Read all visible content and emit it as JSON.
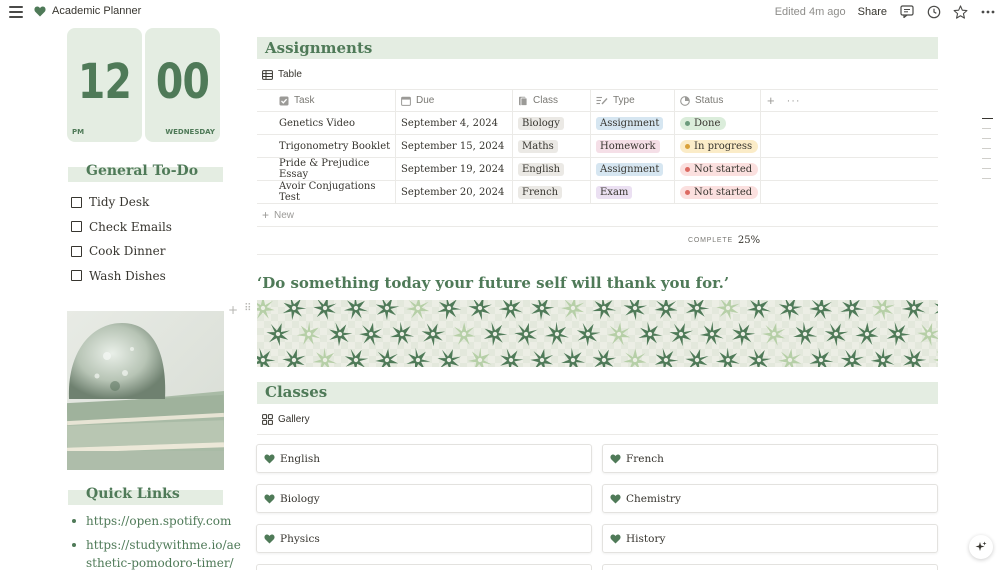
{
  "topbar": {
    "page_title": "Academic Planner",
    "edited": "Edited 4m ago",
    "share": "Share"
  },
  "clock": {
    "hour": "12",
    "minute": "00",
    "ampm": "PM",
    "weekday": "WEDNESDAY"
  },
  "todo": {
    "title": "General To-Do",
    "items": [
      "Tidy Desk",
      "Check Emails",
      "Cook Dinner",
      "Wash Dishes"
    ]
  },
  "quick_links": {
    "title": "Quick Links",
    "links": [
      "https://open.spotify.com",
      "https://studywithme.io/ae",
      "sthetic-pomodoro-timer/"
    ]
  },
  "assignments": {
    "title": "Assignments",
    "view": "Table",
    "columns": [
      "Task",
      "Due",
      "Class",
      "Type",
      "Status"
    ],
    "rows": [
      {
        "task": "Genetics Video",
        "due": "September 4, 2024",
        "class": "Biology",
        "type": "Assignment",
        "status": "Done"
      },
      {
        "task": "Trigonometry Booklet",
        "due": "September 15, 2024",
        "class": "Maths",
        "type": "Homework",
        "status": "In progress"
      },
      {
        "task": "Pride & Prejudice Essay",
        "due": "September 19, 2024",
        "class": "English",
        "type": "Assignment",
        "status": "Not started"
      },
      {
        "task": "Avoir Conjugations Test",
        "due": "September 20, 2024",
        "class": "French",
        "type": "Exam",
        "status": "Not started"
      }
    ],
    "new_label": "New",
    "calc_label": "COMPLETE",
    "calc_value": "25%"
  },
  "quote": "‘Do something today your future self will thank you for.’",
  "classes": {
    "title": "Classes",
    "view": "Gallery",
    "cards": [
      "English",
      "French",
      "Biology",
      "Chemistry",
      "Physics",
      "History"
    ]
  },
  "colors": {
    "accent": "#4f7a58",
    "header_bg": "#e4ede2",
    "tag_gray": "#ebe9e5",
    "tag_blue": "#d6e6f1",
    "tag_purple": "#ebe0f2",
    "tag_pink": "#f5dfe7",
    "status_green": "#dbeddb",
    "status_yellow": "#fbecc8",
    "status_red": "#fbe0df"
  }
}
